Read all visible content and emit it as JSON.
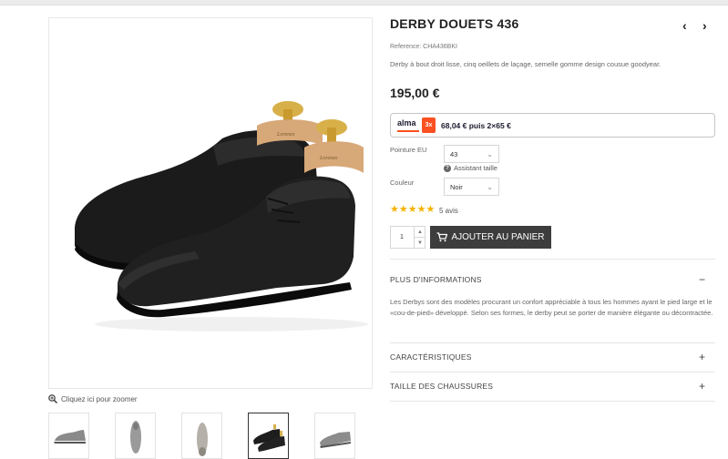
{
  "product": {
    "title": "DERBY DOUETS 436",
    "reference": "Reference: CHA436BKI",
    "description": "Derby à bout droit lisse, cinq oeillets de laçage, semelle gomme design cousue goodyear.",
    "price": "195,00 €"
  },
  "nav": {
    "prev": "‹",
    "next": "›"
  },
  "gallery": {
    "zoom_label": "Cliquez ici pour zoomer",
    "thumbnails": [
      "side-view",
      "top-view",
      "sole-view",
      "pair-view",
      "three-quarter-view"
    ],
    "active_thumbnail": 3
  },
  "alma": {
    "logo": "alma",
    "badge": "3x",
    "text": "68,04 € puis 2×65 €",
    "accent": "#fa5022"
  },
  "options": {
    "size_label": "Pointure EU",
    "size_value": "43",
    "size_assist": "Assistant taille",
    "color_label": "Couleur",
    "color_value": "Noir"
  },
  "reviews": {
    "stars": "★★★★★",
    "rating": 5,
    "count_label": "5 avis"
  },
  "cart": {
    "quantity": "1",
    "qty_up": "▲",
    "qty_down": "▼",
    "add_label": "AJOUTER AU PANIER"
  },
  "accordion": [
    {
      "title": "PLUS D'INFORMATIONS",
      "sign": "−",
      "content": "Les Derbys sont des modèles procurant un confort appréciable à tous les hommes ayant le pied large et le «cou-de-pied» développé. Selon ses formes, le derby peut se porter de manière élégante ou décontractée."
    },
    {
      "title": "CARACTÉRISTIQUES",
      "sign": "+"
    },
    {
      "title": "TAILLE DES CHAUSSURES",
      "sign": "+"
    }
  ],
  "icons": {
    "zoom": "magnifier-plus-icon",
    "cart": "cart-icon",
    "assist": "question-circle-icon"
  }
}
